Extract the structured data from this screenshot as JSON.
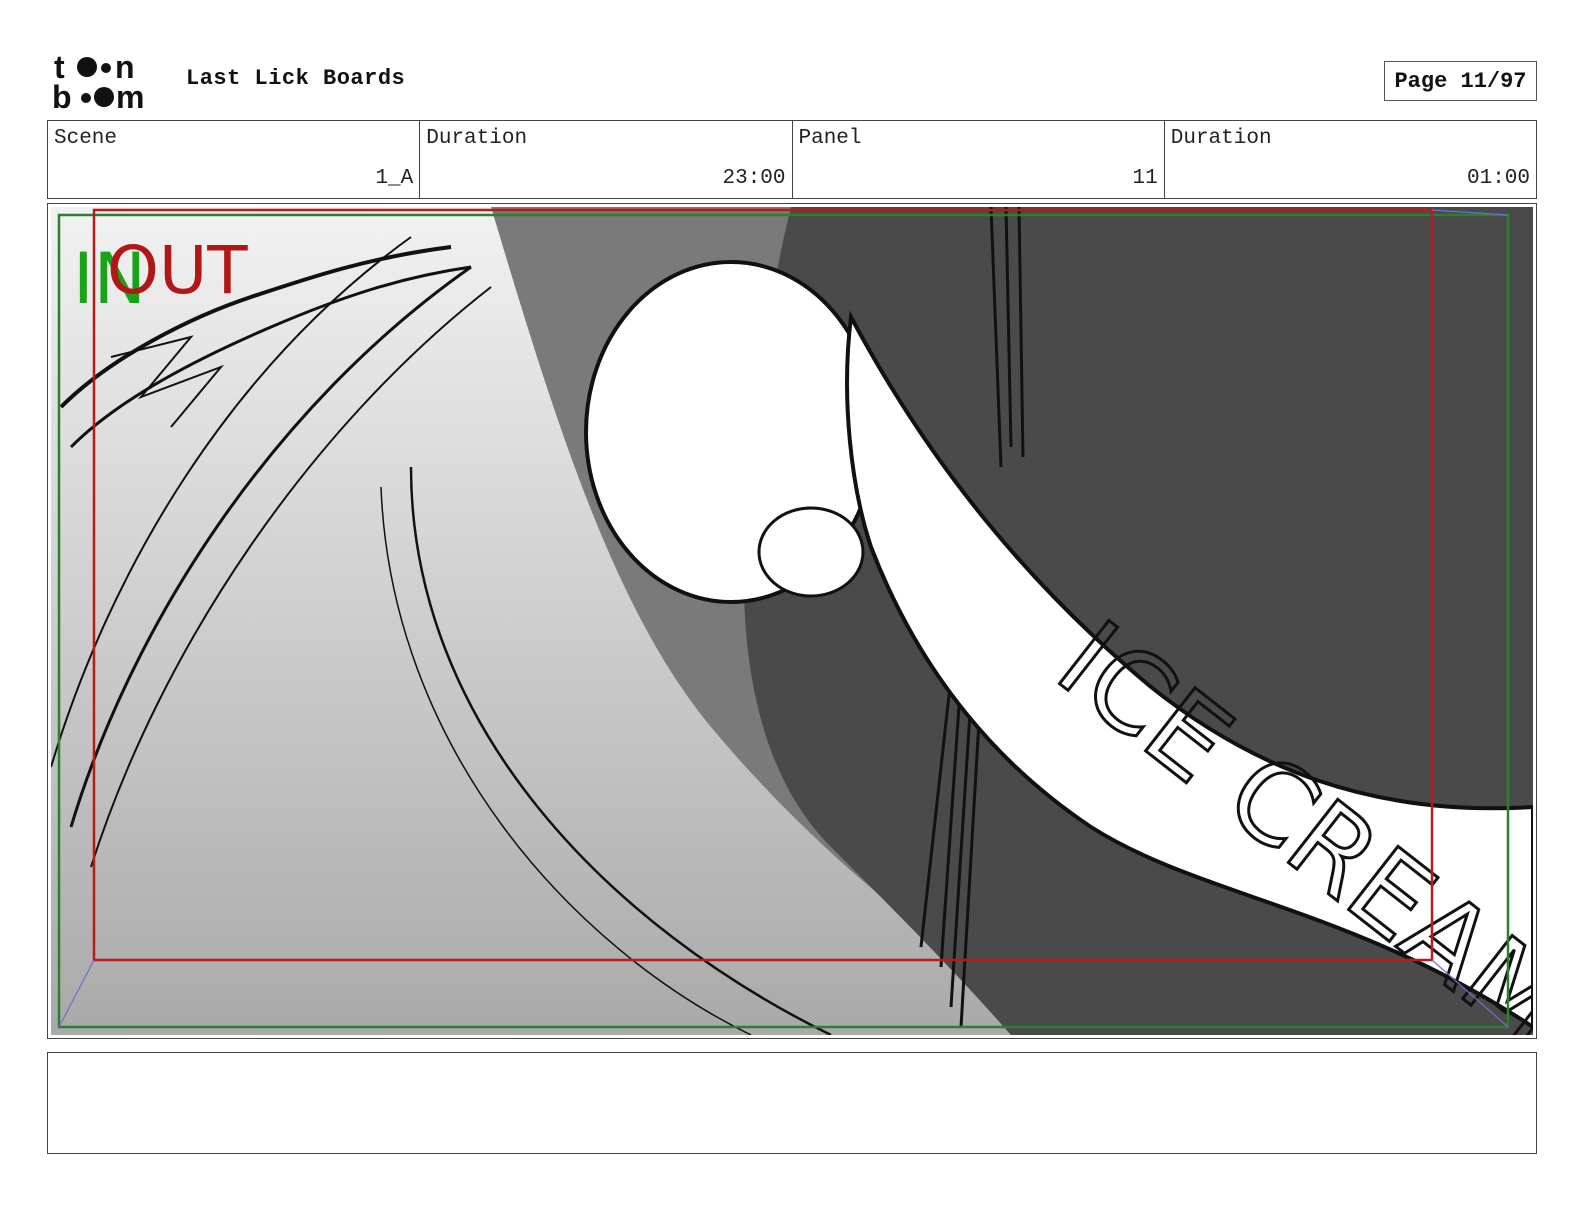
{
  "header": {
    "logo_text_top": "toon",
    "logo_text_bottom": "boom",
    "project_title": "Last Lick Boards",
    "page_label": "Page 11/97"
  },
  "info": {
    "scene_label": "Scene",
    "scene_value": "1_A",
    "duration_label": "Duration",
    "duration_value": "23:00",
    "panel_label": "Panel",
    "panel_value": "11",
    "panel_duration_label": "Duration",
    "panel_duration_value": "01:00"
  },
  "panel": {
    "in_marker": "IN",
    "out_marker": "OUT",
    "banner_text": "ICE CREAM",
    "colors": {
      "in_green": "#1aa31a",
      "out_red": "#b01818",
      "safe_frame_green": "#2e7d32",
      "camera_frame_red": "#b71c1c",
      "dark_wall": "#4a4a4a"
    }
  },
  "notes": {
    "text": ""
  }
}
